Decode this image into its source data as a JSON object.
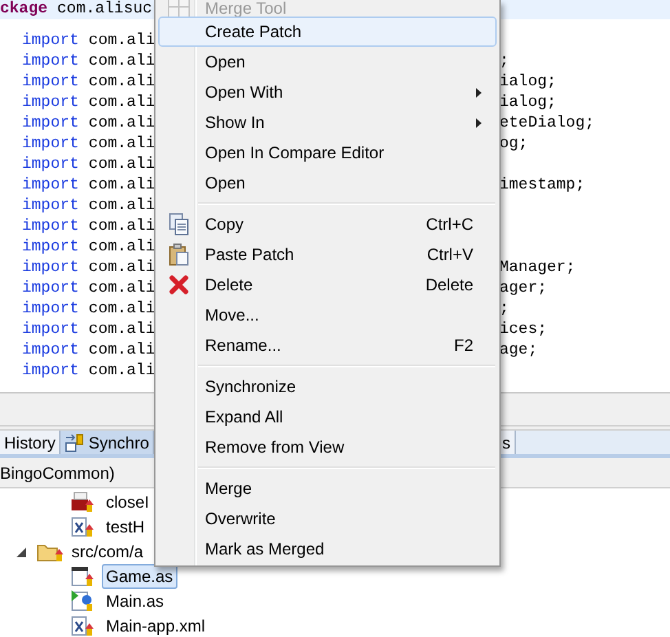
{
  "editor": {
    "package_line": {
      "keyword": "ckage",
      "text": "com.alisuc"
    },
    "lines": [
      {
        "keyword": "import",
        "text": "com.ali"
      },
      {
        "keyword": "import",
        "text": "com.ali",
        "suffix": ";"
      },
      {
        "keyword": "import",
        "text": "com.ali",
        "suffix": "ialog;"
      },
      {
        "keyword": "import",
        "text": "com.ali",
        "suffix": "ialog;"
      },
      {
        "keyword": "import",
        "text": "com.ali",
        "suffix": "eteDialog;"
      },
      {
        "keyword": "import",
        "text": "com.ali",
        "suffix": "og;"
      },
      {
        "keyword": "import",
        "text": "com.ali"
      },
      {
        "keyword": "import",
        "text": "com.ali",
        "suffix": "imestamp;"
      },
      {
        "keyword": "import",
        "text": "com.ali"
      },
      {
        "keyword": "import",
        "text": "com.ali"
      },
      {
        "keyword": "import",
        "text": "com.ali"
      },
      {
        "keyword": "import",
        "text": "com.ali",
        "suffix": "Manager;"
      },
      {
        "keyword": "import",
        "text": "com.ali",
        "suffix": "ager;"
      },
      {
        "keyword": "import",
        "text": "com.ali",
        "suffix": ";"
      },
      {
        "keyword": "import",
        "text": "com.ali",
        "suffix": "ices;"
      },
      {
        "keyword": "import",
        "text": "com.ali",
        "suffix": "age;"
      },
      {
        "keyword": "import",
        "text": "com.ali"
      }
    ]
  },
  "tabs": [
    {
      "label": "History",
      "selected": false
    },
    {
      "label": "Synchro",
      "selected": true
    },
    {
      "label": "s",
      "selected": false
    }
  ],
  "breadcrumb": "BingoCommon)",
  "tree": {
    "continued_children": [
      {
        "label": "closeI",
        "kind": "image",
        "selected": false
      },
      {
        "label": "testH",
        "kind": "xml",
        "selected": false
      }
    ],
    "nodes": [
      {
        "label": "src/com/a",
        "kind": "folder",
        "expanded": true,
        "selected": false,
        "children": [
          {
            "label": "Game.as",
            "kind": "code",
            "selected": true
          },
          {
            "label": "Main.as",
            "kind": "main",
            "selected": false
          },
          {
            "label": "Main-app.xml",
            "kind": "xml",
            "selected": false
          }
        ]
      }
    ]
  },
  "menu": [
    {
      "kind": "item",
      "label": "Merge Tool",
      "disabled": true,
      "selected": false
    },
    {
      "kind": "item",
      "label": "Create Patch",
      "disabled": false,
      "selected": true
    },
    {
      "kind": "item",
      "label": "Open",
      "disabled": false,
      "selected": false
    },
    {
      "kind": "item",
      "label": "Open With",
      "disabled": false,
      "selected": false,
      "submenu": true
    },
    {
      "kind": "item",
      "label": "Show In",
      "disabled": false,
      "selected": false,
      "submenu": true
    },
    {
      "kind": "item",
      "label": "Open In Compare Editor",
      "disabled": false,
      "selected": false
    },
    {
      "kind": "item",
      "label": "Open",
      "disabled": false,
      "selected": false
    },
    {
      "kind": "separator"
    },
    {
      "kind": "item",
      "label": "Copy",
      "shortcut": "Ctrl+C",
      "disabled": false,
      "selected": false
    },
    {
      "kind": "item",
      "label": "Paste Patch",
      "shortcut": "Ctrl+V",
      "disabled": false,
      "selected": false
    },
    {
      "kind": "item",
      "label": "Delete",
      "shortcut": "Delete",
      "disabled": false,
      "selected": false
    },
    {
      "kind": "item",
      "label": "Move...",
      "disabled": false,
      "selected": false
    },
    {
      "kind": "item",
      "label": "Rename...",
      "shortcut": "F2",
      "disabled": false,
      "selected": false
    },
    {
      "kind": "separator"
    },
    {
      "kind": "item",
      "label": "Synchronize",
      "disabled": false,
      "selected": false
    },
    {
      "kind": "item",
      "label": "Expand All",
      "disabled": false,
      "selected": false
    },
    {
      "kind": "item",
      "label": "Remove from View",
      "disabled": false,
      "selected": false
    },
    {
      "kind": "separator"
    },
    {
      "kind": "item",
      "label": "Merge",
      "disabled": false,
      "selected": false
    },
    {
      "kind": "item",
      "label": "Overwrite",
      "disabled": false,
      "selected": false
    },
    {
      "kind": "item",
      "label": "Mark as Merged",
      "disabled": false,
      "selected": false
    }
  ]
}
